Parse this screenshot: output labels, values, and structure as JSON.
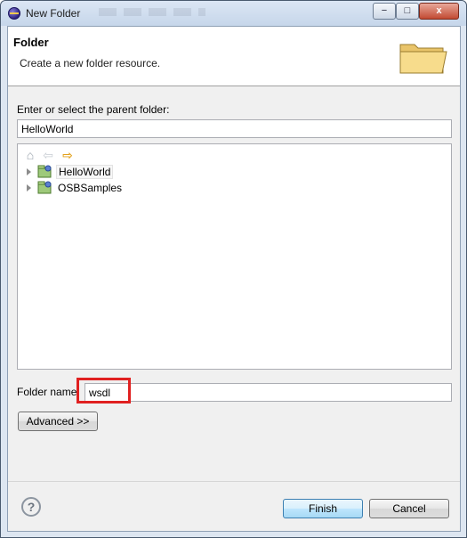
{
  "window": {
    "title": "New Folder",
    "controls": {
      "minimize": "−",
      "maximize": "□",
      "close": "x"
    }
  },
  "header": {
    "title": "Folder",
    "description": "Create a new folder resource.",
    "icon": "folder-icon"
  },
  "parent": {
    "label": "Enter or select the parent folder:",
    "value": "HelloWorld"
  },
  "tree": {
    "toolbar": [
      {
        "name": "home-icon",
        "glyph": "⌂"
      },
      {
        "name": "back-icon",
        "glyph": "⇦"
      },
      {
        "name": "forward-icon",
        "glyph": "⇨"
      }
    ],
    "items": [
      {
        "label": "HelloWorld",
        "selected": true
      },
      {
        "label": "OSBSamples",
        "selected": false
      }
    ]
  },
  "folder_name": {
    "label": "Folder name",
    "value": "wsdl"
  },
  "buttons": {
    "advanced": "Advanced >>",
    "finish": "Finish",
    "cancel": "Cancel",
    "help": "?"
  },
  "colors": {
    "highlight": "#e02020",
    "window_frame": "#dde6f1",
    "dialog_bg": "#f0f0f0"
  }
}
